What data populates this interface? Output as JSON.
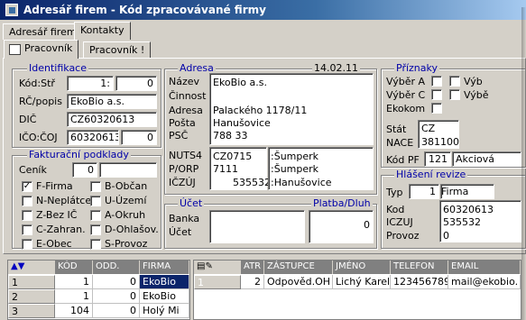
{
  "window": {
    "title": "Adresář firem - Kód zpracovávané firmy"
  },
  "menu": {
    "tab_a": "Adresář firem",
    "tab_b": "Kontakty"
  },
  "tabs": {
    "a": "Pracovník",
    "b": "Pracovník !"
  },
  "ident": {
    "title": "Identifikace",
    "kod_label": "Kód:Stř",
    "kod_val": "1:",
    "str_val": "0",
    "rc_label": "RČ/popis",
    "rc_val": "EkoBio a.s.",
    "dic_label": "DIČ",
    "dic_val": "CZ60320613",
    "ico_label": "IČO:ČOJ",
    "ico_val": "60320613:",
    "coj_val": "0"
  },
  "fakt": {
    "title": "Fakturační podklady",
    "cenik_label": "Ceník",
    "cenik_val": "0",
    "checks": [
      {
        "mark": "✓",
        "label": "F-Firma"
      },
      {
        "mark": "",
        "label": "B-Občan"
      },
      {
        "mark": "",
        "label": "N-Neplátce"
      },
      {
        "mark": "",
        "label": "U-Území"
      },
      {
        "mark": "",
        "label": "Z-Bez IČ"
      },
      {
        "mark": "",
        "label": "A-Okruh"
      },
      {
        "mark": "",
        "label": "C-Zahran."
      },
      {
        "mark": "",
        "label": "D-Ohlašov."
      },
      {
        "mark": "",
        "label": "E-Obec"
      },
      {
        "mark": "",
        "label": "S-Provoz"
      }
    ]
  },
  "adresa": {
    "title": "Adresa",
    "date": "14.02.11",
    "labels": [
      "Název",
      "Činnost",
      "Adresa",
      "Pošta",
      "PSČ"
    ],
    "values": [
      "EkoBio a.s.",
      "",
      "Palackého 1178/11",
      "Hanušovice",
      "788 33"
    ],
    "nuts_labels": [
      "NUTS4",
      "P/ORP",
      "IČZÚJ"
    ],
    "nuts_codes": [
      "CZ0715",
      "7111",
      "535532"
    ],
    "nuts_names": [
      ":Šumperk",
      ":Šumperk",
      ":Hanušovice"
    ]
  },
  "ucet": {
    "title": "Účet",
    "platba_title": "Platba/Dluh",
    "banka_label": "Banka",
    "ucet_label": "Účet",
    "platba_val": "0"
  },
  "priznaky": {
    "title": "Příznaky",
    "checks": [
      {
        "label": "Výběr A"
      },
      {
        "label": "Výb"
      },
      {
        "label": "Výběr C"
      },
      {
        "label": "Výbě"
      },
      {
        "label": "Ekokom"
      }
    ],
    "stat_label": "Stát",
    "stat_val": "CZ",
    "nace_label": "NACE",
    "nace_val": "381100",
    "kodpf_label": "Kód PF",
    "kodpf_num": "121",
    "kodpf_txt": "Akciová"
  },
  "hlaseni": {
    "title": "Hlášení revize",
    "typ_label": "Typ",
    "typ_num": "1",
    "typ_txt": "Firma",
    "kod_label": "Kod",
    "kod_val": "60320613",
    "iczuj_label": "ICZUJ",
    "iczuj_val": "535532",
    "provoz_label": "Provoz",
    "provoz_val": "0"
  },
  "grid_left": {
    "headers": [
      "KÓD",
      "ODD.",
      "FIRMA"
    ],
    "rows": [
      {
        "num": "1",
        "kod": "1",
        "odd": "0",
        "firma": "EkoBio"
      },
      {
        "num": "2",
        "kod": "1",
        "odd": "0",
        "firma": "EkoBio"
      },
      {
        "num": "3",
        "kod": "104",
        "odd": "0",
        "firma": "Holý Mi"
      }
    ]
  },
  "grid_right": {
    "headers": [
      "ATR",
      "ZÁSTUPCE",
      "JMÉNO",
      "TELEFON",
      "EMAIL"
    ],
    "rows": [
      {
        "num": "1",
        "atr": "2",
        "zastupce": "Odpověd.OH",
        "jmeno": "Lichý Karel",
        "telefon": "123456789",
        "email": "mail@ekobio."
      }
    ]
  },
  "colors": {
    "title_dark": "#0a246a",
    "title_light": "#a6caf0",
    "group_title": "#0000a8",
    "face": "#d4d0c8",
    "grid_header": "#808080"
  }
}
